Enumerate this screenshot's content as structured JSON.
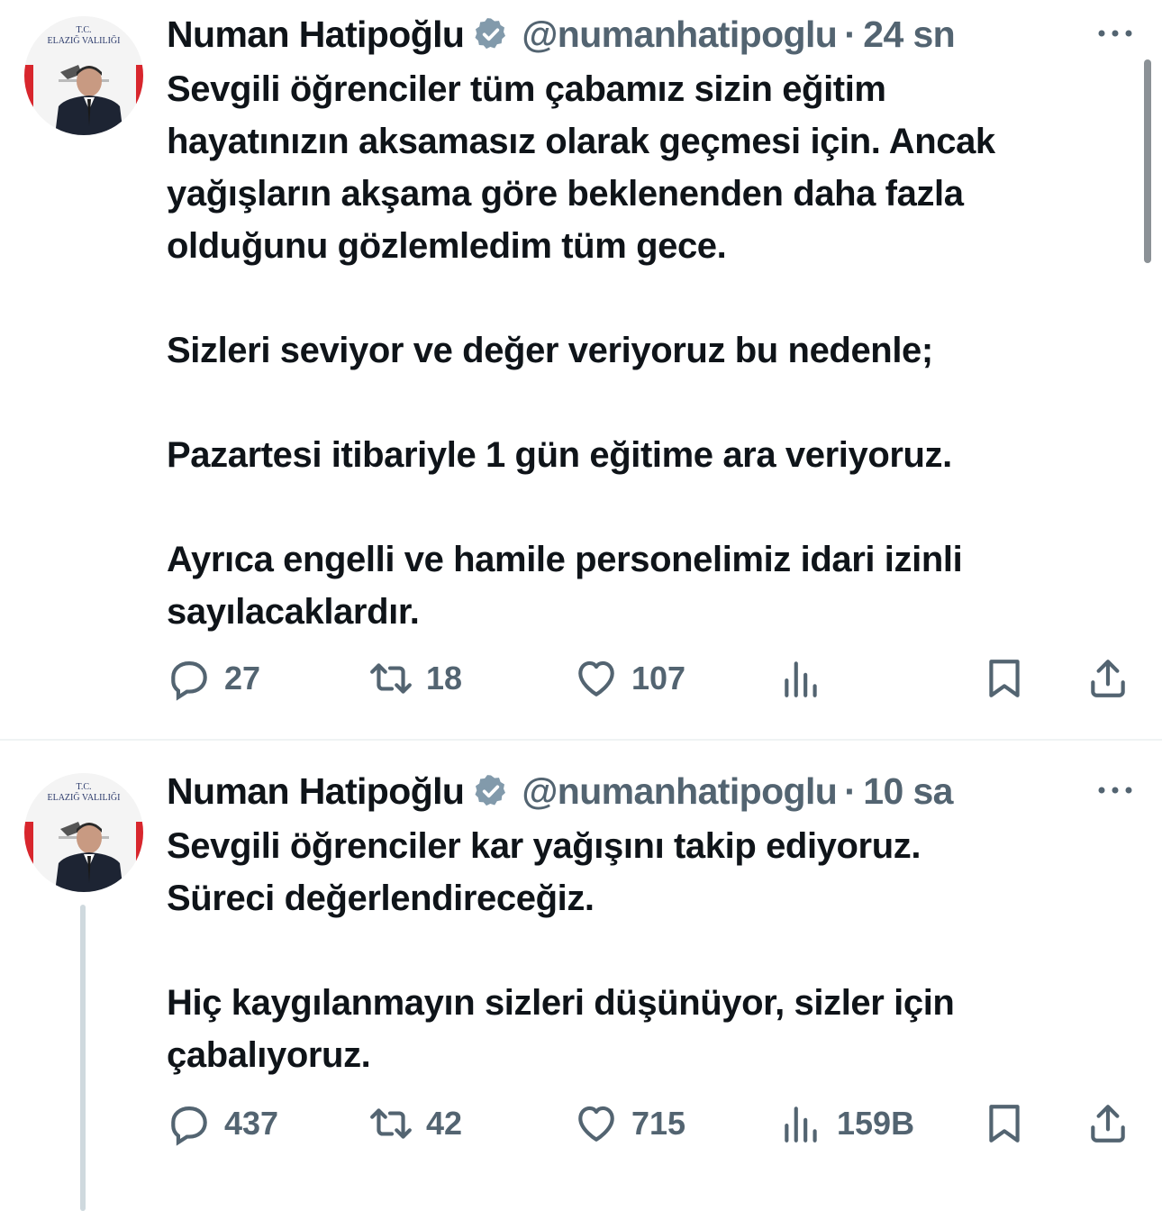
{
  "tweets": [
    {
      "author": {
        "name": "Numan Hatipoğlu",
        "handle": "@numanhatipoglu",
        "avatar_caption": "T.C. ELAZIĞ VALILIĞI",
        "verified_icon": "verified-badge-icon"
      },
      "separator": "·",
      "time": "24 sn",
      "text": "Sevgili öğrenciler tüm çabamız sizin eğitim\nhayatınızın aksamasız olarak geçmesi için. Ancak\nyağışların akşama göre beklenenden daha fazla\nolduğunu gözlemledim tüm gece.\n\nSizleri seviyor ve değer veriyoruz bu nedenle;\n\nPazartesi itibariyle 1 gün eğitime ara veriyoruz.\n\nAyrıca engelli ve hamile personelimiz idari izinli\nsayılacaklardır.",
      "stats": {
        "replies": "27",
        "retweets": "18",
        "likes": "107",
        "views": ""
      }
    },
    {
      "author": {
        "name": "Numan Hatipoğlu",
        "handle": "@numanhatipoglu",
        "avatar_caption": "T.C. ELAZIĞ VALILIĞI",
        "verified_icon": "verified-badge-icon"
      },
      "separator": "·",
      "time": "10 sa",
      "text": "Sevgili öğrenciler kar yağışını takip ediyoruz.\nSüreci değerlendireceğiz.\n\nHiç kaygılanmayın sizleri düşünüyor, sizler için\nçabalıyoruz.",
      "stats": {
        "replies": "437",
        "retweets": "42",
        "likes": "715",
        "views": "159B"
      }
    }
  ],
  "colors": {
    "text": "#0f1419",
    "secondary": "#536471",
    "verified_badge": "#829aab",
    "divider": "#eff3f4",
    "thread_line": "#cfd9de"
  }
}
